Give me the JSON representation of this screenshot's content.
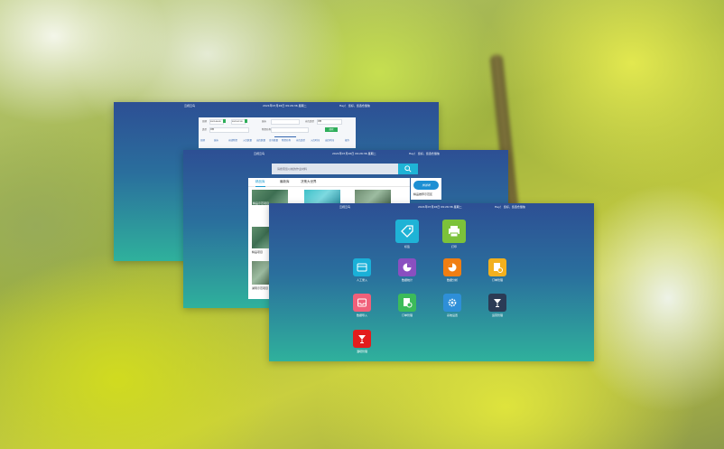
{
  "background": {
    "description_colors": [
      "#b9c97a",
      "#c9cf3f",
      "#f0f5f0"
    ]
  },
  "colors": {
    "window_gradient_top": "#2d4f94",
    "window_gradient_bottom": "#2fb19c",
    "accent_blue": "#1fb3d6",
    "accent_green": "#2fae5a"
  },
  "window1": {
    "brand": "云视云鸟",
    "datetime": "2021年07月26日 09:26:36 星期二",
    "user": "Hey！ 您好，您选仓储信",
    "filter": {
      "row1_label": "日期",
      "date_from": "2021-06-26",
      "date_to": "2021-07-26",
      "field2_label": "城市",
      "field3_label": "仓库类型",
      "field3_value": "全部",
      "row2_label": "类型",
      "row2_value": "全部",
      "field4_label": "物资名称",
      "search_button": "搜索"
    },
    "tabs": [
      "日期",
      "城市",
      "仓储物资",
      "入库数量",
      "出库数量",
      "库存数量",
      "物资名称",
      "仓库类型",
      "入库时间",
      "出库时间",
      "操作"
    ]
  },
  "window2": {
    "brand": "云视云鸟",
    "datetime": "2021年07月26日 09:26:36 星期二",
    "user": "Hey！ 您好，您选仓储信",
    "search_placeholder": "请搜索您以前的作业材料",
    "tabs": [
      "精品库",
      "最新库",
      "决策大世界"
    ],
    "cards": [
      {
        "caption": "精品示范项目"
      },
      {
        "caption": ""
      },
      {
        "caption": ""
      }
    ],
    "list": [
      {
        "caption": "精品项目"
      },
      {
        "caption": "湖南示范项目"
      }
    ],
    "side": {
      "logo": "旅游通",
      "text": "精品推荐示范区"
    }
  },
  "window3": {
    "brand": "云视云鸟",
    "datetime": "2021年07月26日 09:26:36 星期二",
    "user": "Hey！ 您好，您选仓储信",
    "apps": [
      {
        "label": "标签",
        "color": "#1fb3d6",
        "icon": "tag-icon"
      },
      {
        "label": "打印",
        "color": "#7cc23a",
        "icon": "printer-icon"
      },
      {
        "label": "人工录入",
        "color": "#1ab0d8",
        "icon": "card-icon"
      },
      {
        "label": "数据统计",
        "color": "#8a4fc0",
        "icon": "pie-chart-icon"
      },
      {
        "label": "数据分析",
        "color": "#f07e12",
        "icon": "pie-chart-icon"
      },
      {
        "label": "订单管理",
        "color": "#f2b01e",
        "icon": "document-settings-icon"
      },
      {
        "label": "数据导入",
        "color": "#f0607a",
        "icon": "inbox-icon"
      },
      {
        "label": "订单管理",
        "color": "#3cbb5a",
        "icon": "document-gear-icon"
      },
      {
        "label": "系统设置",
        "color": "#2e8fd8",
        "icon": "gear-icon"
      },
      {
        "label": "运营管理",
        "color": "#2b3b55",
        "icon": "cocktail-icon"
      },
      {
        "label": "酒吧管理",
        "color": "#e31c1c",
        "icon": "cocktail-icon"
      }
    ]
  }
}
